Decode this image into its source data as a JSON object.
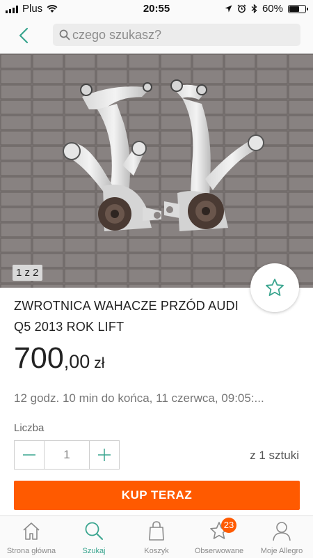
{
  "status_bar": {
    "carrier": "Plus",
    "time": "20:55",
    "battery": "60%"
  },
  "header": {
    "search_placeholder": "czego szukasz?"
  },
  "listing": {
    "photo_counter": "1 z 2",
    "title": "ZWROTNICA WAHACZE PRZÓD AUDI Q5 2013 ROK LIFT",
    "price_main": "700",
    "price_decimal": ",00",
    "price_currency": "zł",
    "time_left": "12 godz. 10 min do końca, 11 czerwca, 09:05:...",
    "quantity_label": "Liczba",
    "quantity_value": "1",
    "quantity_available": "z 1 sztuki",
    "buy_label": "KUP TERAZ"
  },
  "colors": {
    "accent": "#3aa58f",
    "buy": "#ff5a00"
  },
  "tabbar": {
    "items": [
      {
        "label": "Strona główna",
        "icon": "home-icon"
      },
      {
        "label": "Szukaj",
        "icon": "search-icon",
        "active": true
      },
      {
        "label": "Koszyk",
        "icon": "cart-icon"
      },
      {
        "label": "Obserwowane",
        "icon": "star-icon",
        "badge": "23"
      },
      {
        "label": "Moje Allegro",
        "icon": "user-icon"
      }
    ]
  }
}
